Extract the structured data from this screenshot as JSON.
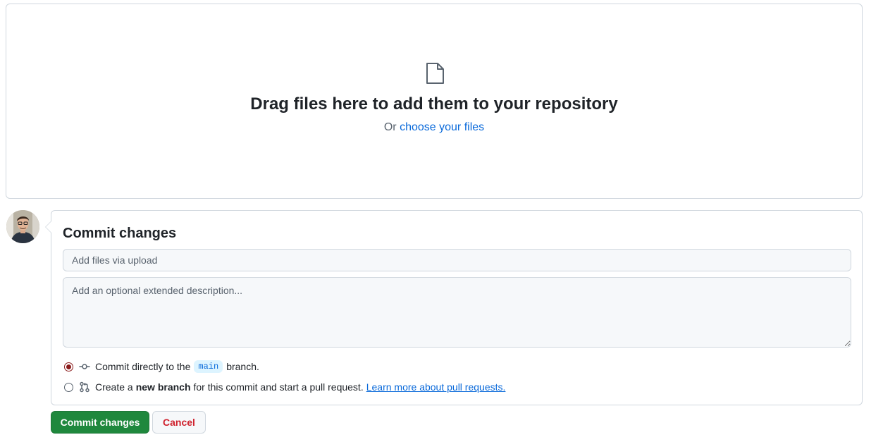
{
  "dropzone": {
    "title": "Drag files here to add them to your repository",
    "sub_prefix": "Or",
    "sub_link": "choose your files",
    "icon": "file-icon"
  },
  "commit": {
    "title": "Commit changes",
    "summary_placeholder": "Add files via upload",
    "description_placeholder": "Add an optional extended description...",
    "option_direct": {
      "before": "Commit directly to the",
      "branch": "main",
      "after": "branch.",
      "selected": true,
      "icon": "git-commit-icon"
    },
    "option_new_branch": {
      "before": "Create a",
      "bold": "new branch",
      "after": "for this commit and start a pull request.",
      "link": "Learn more about pull requests.",
      "selected": false,
      "icon": "git-pull-request-icon"
    }
  },
  "buttons": {
    "commit_label": "Commit changes",
    "cancel_label": "Cancel"
  },
  "colors": {
    "primary": "#1f883d",
    "link": "#0969da",
    "danger": "#cf222e",
    "border": "#d0d7de"
  }
}
